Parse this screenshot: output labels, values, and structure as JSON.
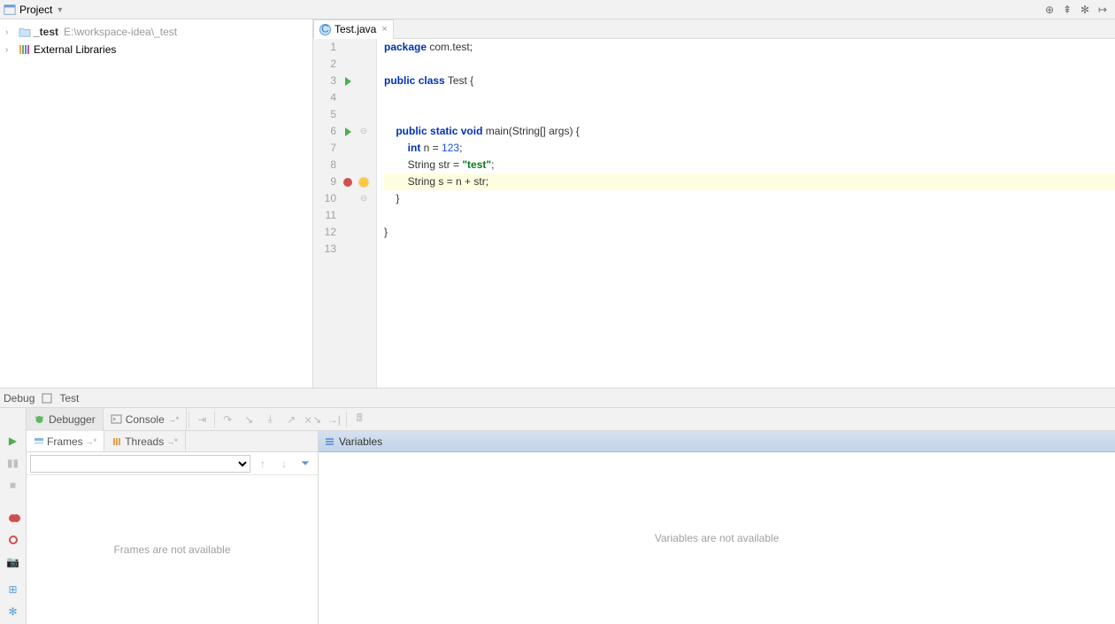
{
  "project_header": {
    "title": "Project",
    "icons": [
      "target-icon",
      "collapse-icon",
      "gear-icon",
      "hide-icon"
    ]
  },
  "tree": {
    "root": {
      "name": "_test",
      "path": "E:\\workspace-idea\\_test"
    },
    "ext_lib": "External Libraries"
  },
  "tab": {
    "filename": "Test.java"
  },
  "code": {
    "lines": [
      {
        "n": "1",
        "tokens": [
          [
            "kw",
            "package"
          ],
          [
            "",
            " com.test;"
          ]
        ]
      },
      {
        "n": "2",
        "tokens": []
      },
      {
        "n": "3",
        "run": true,
        "tokens": [
          [
            "kw",
            "public"
          ],
          [
            "",
            " "
          ],
          [
            "kw",
            "class"
          ],
          [
            "",
            " Test {"
          ]
        ]
      },
      {
        "n": "4",
        "tokens": []
      },
      {
        "n": "5",
        "tokens": []
      },
      {
        "n": "6",
        "run": true,
        "fold": "⊖",
        "tokens": [
          [
            "",
            "    "
          ],
          [
            "kw",
            "public"
          ],
          [
            "",
            " "
          ],
          [
            "kw",
            "static"
          ],
          [
            "",
            " "
          ],
          [
            "kw",
            "void"
          ],
          [
            "",
            " main(String[] args) {"
          ]
        ]
      },
      {
        "n": "7",
        "tokens": [
          [
            "",
            "        "
          ],
          [
            "kw",
            "int"
          ],
          [
            "",
            " n = "
          ],
          [
            "num",
            "123"
          ],
          [
            "",
            ";"
          ]
        ]
      },
      {
        "n": "8",
        "tokens": [
          [
            "",
            "        String str = "
          ],
          [
            "str",
            "\"test\""
          ],
          [
            "",
            ";"
          ]
        ]
      },
      {
        "n": "9",
        "bp": true,
        "bulb": true,
        "hl": true,
        "tokens": [
          [
            "",
            "        String s = n + str;"
          ]
        ]
      },
      {
        "n": "10",
        "fold": "⊖",
        "tokens": [
          [
            "",
            "    }"
          ]
        ]
      },
      {
        "n": "11",
        "tokens": []
      },
      {
        "n": "12",
        "tokens": [
          [
            "",
            "}"
          ]
        ]
      },
      {
        "n": "13",
        "tokens": []
      }
    ]
  },
  "debug_strip": {
    "debug": "Debug",
    "test": "Test"
  },
  "debugger": {
    "tabs": {
      "debugger": "Debugger",
      "console": "Console"
    },
    "frames": {
      "tab_frames": "Frames",
      "tab_threads": "Threads",
      "empty": "Frames are not available"
    },
    "variables": {
      "header": "Variables",
      "empty": "Variables are not available"
    }
  }
}
